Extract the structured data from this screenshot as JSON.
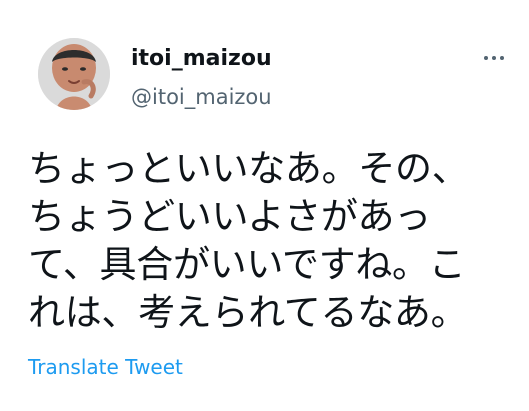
{
  "tweet": {
    "display_name": "itoi_maizou",
    "handle": "@itoi_maizou",
    "text_lines": [
      "ちょっといいなあ。その、",
      "ちょうどいいよさがあっ",
      "て、具合がいいですね。こ",
      "れは、考えられてるなあ。"
    ],
    "translate_label": "Translate Tweet"
  },
  "icons": {
    "avatar": "profile-photo",
    "more": "more-options-icon"
  },
  "colors": {
    "text": "#0f1419",
    "secondary": "#536471",
    "link": "#1d9bf0",
    "background": "#ffffff"
  }
}
